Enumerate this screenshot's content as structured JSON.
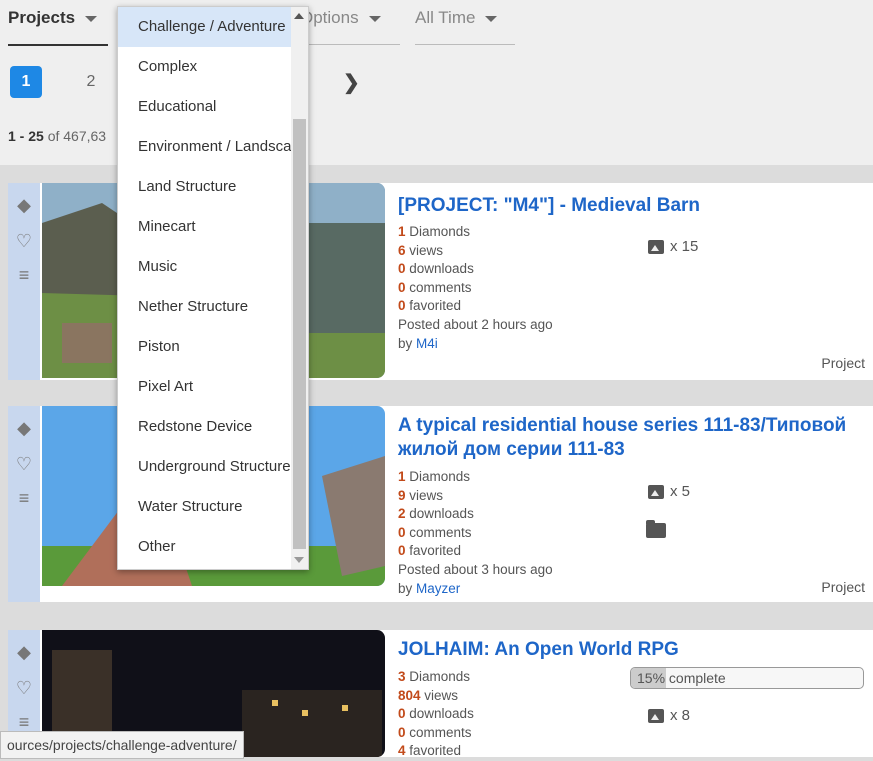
{
  "filters": {
    "projects": "Projects",
    "options": "Options",
    "time": "All Time"
  },
  "pagination": {
    "pages": [
      "1",
      "2"
    ]
  },
  "results": {
    "range": "1 - 25",
    "of_text": " of 467,63"
  },
  "dropdown": {
    "items": [
      "Challenge / Adventure",
      "Complex",
      "Educational",
      "Environment / Landscaping",
      "Land Structure",
      "Minecart",
      "Music",
      "Nether Structure",
      "Piston",
      "Pixel Art",
      "Redstone Device",
      "Underground Structure",
      "Water Structure",
      "Other"
    ],
    "selected": "Challenge / Adventure"
  },
  "projects": [
    {
      "title": "[PROJECT: \"M4\"] - Medieval Barn",
      "diamonds": "1",
      "diamonds_label": " Diamonds",
      "views": "6",
      "views_label": " views",
      "downloads": "0",
      "downloads_label": " downloads",
      "comments": "0",
      "comments_label": " comments",
      "favorited": "0",
      "favorited_label": " favorited",
      "posted": "Posted about 2 hours ago",
      "by": "by ",
      "author": "M4i",
      "images": "x 15",
      "type": "Project"
    },
    {
      "title": "A typical residential house series 111-83/Типовой жилой дом серии 111-83",
      "diamonds": "1",
      "diamonds_label": " Diamonds",
      "views": "9",
      "views_label": " views",
      "downloads": "2",
      "downloads_label": " downloads",
      "comments": "0",
      "comments_label": " comments",
      "favorited": "0",
      "favorited_label": " favorited",
      "posted": "Posted about 3 hours ago",
      "by": "by ",
      "author": "Mayzer",
      "images": "x 5",
      "type": "Project"
    },
    {
      "title": "JOLHAIM: An Open World RPG",
      "diamonds": "3",
      "diamonds_label": " Diamonds",
      "views": "804",
      "views_label": " views",
      "downloads": "0",
      "downloads_label": " downloads",
      "comments": "0",
      "comments_label": " comments",
      "favorited": "4",
      "favorited_label": " favorited",
      "images": "x 8",
      "progress_text": "15% complete",
      "progress": 0.15
    }
  ],
  "status_url": "ources/projects/challenge-adventure/",
  "colors": {
    "accent": "#1e88e5",
    "link": "#1e66c8",
    "stat": "#c24a1a",
    "sidebar": "#c8d7ee"
  }
}
